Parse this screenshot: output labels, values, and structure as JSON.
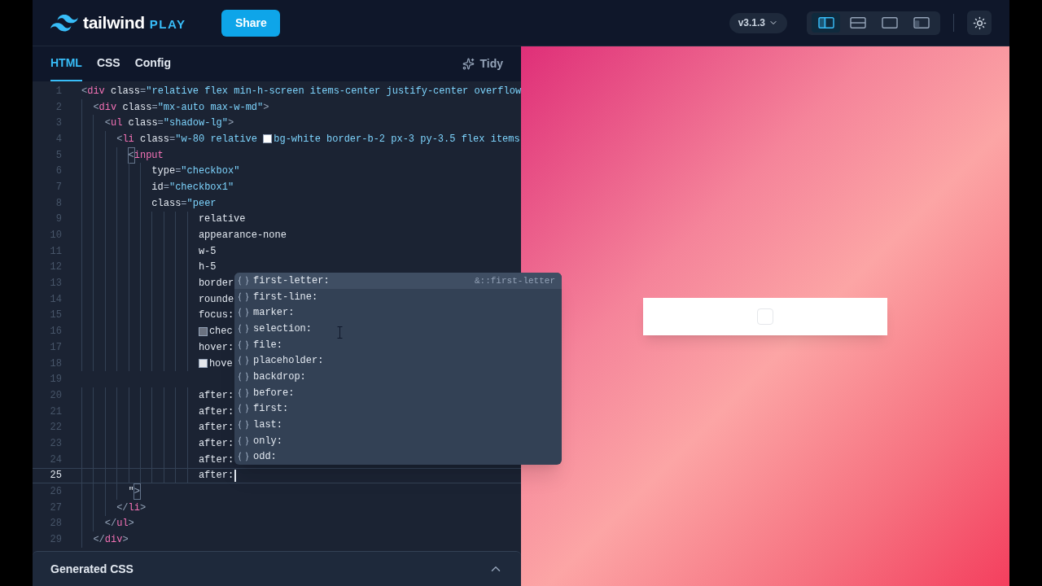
{
  "header": {
    "logo_text": "tailwind",
    "logo_suffix": "PLAY",
    "share_button": "Share",
    "version": "v3.1.3",
    "layouts": [
      {
        "kind": "vertical",
        "selected": true
      },
      {
        "kind": "horizontal",
        "selected": false
      },
      {
        "kind": "preview",
        "selected": false
      },
      {
        "kind": "responsive",
        "selected": false
      }
    ]
  },
  "tabs": [
    {
      "label": "HTML",
      "selected": true
    },
    {
      "label": "CSS",
      "selected": false
    },
    {
      "label": "Config",
      "selected": false
    }
  ],
  "tidy_button": "Tidy",
  "editor": {
    "lines": [
      {
        "number": "1",
        "current": false,
        "tokens": [
          {
            "kind": "p",
            "t": "<"
          },
          {
            "kind": "tag",
            "t": "div"
          },
          {
            "kind": "attr",
            "t": " class"
          },
          {
            "kind": "p",
            "t": "="
          },
          {
            "kind": "str",
            "t": "\"relative flex min-h-screen items-center justify-center overflow"
          }
        ]
      },
      {
        "number": "2",
        "current": false,
        "tokens": [
          {
            "kind": "p",
            "t": "  <"
          },
          {
            "kind": "tag",
            "t": "div"
          },
          {
            "kind": "attr",
            "t": " class"
          },
          {
            "kind": "p",
            "t": "="
          },
          {
            "kind": "str",
            "t": "\"mx-auto max-w-md\""
          },
          {
            "kind": "p",
            "t": ">"
          }
        ]
      },
      {
        "number": "3",
        "current": false,
        "tokens": [
          {
            "kind": "p",
            "t": "    <"
          },
          {
            "kind": "tag",
            "t": "ul"
          },
          {
            "kind": "attr",
            "t": " class"
          },
          {
            "kind": "p",
            "t": "="
          },
          {
            "kind": "str",
            "t": "\"shadow-lg\""
          },
          {
            "kind": "p",
            "t": ">"
          }
        ]
      },
      {
        "number": "4",
        "current": false,
        "tokens": [
          {
            "kind": "p",
            "t": "      <"
          },
          {
            "kind": "tag",
            "t": "li"
          },
          {
            "kind": "attr",
            "t": " class"
          },
          {
            "kind": "p",
            "t": "="
          },
          {
            "kind": "str",
            "t": "\"w-80 relative "
          },
          {
            "kind": "str",
            "color": "#ffffff",
            "t": "bg-white border-b-2 px-3 py-3.5 flex items"
          }
        ]
      },
      {
        "number": "5",
        "current": false,
        "tokens": [
          {
            "kind": "match",
            "t": "        <"
          },
          {
            "kind": "tag",
            "t": "input"
          }
        ]
      },
      {
        "number": "6",
        "current": false,
        "tokens": [
          {
            "kind": "attr",
            "t": "            type"
          },
          {
            "kind": "p",
            "t": "="
          },
          {
            "kind": "str",
            "t": "\"checkbox\""
          }
        ]
      },
      {
        "number": "7",
        "current": false,
        "tokens": [
          {
            "kind": "attr",
            "t": "            id"
          },
          {
            "kind": "p",
            "t": "="
          },
          {
            "kind": "str",
            "t": "\"checkbox1\""
          }
        ]
      },
      {
        "number": "8",
        "current": false,
        "tokens": [
          {
            "kind": "attr",
            "t": "            class"
          },
          {
            "kind": "p",
            "t": "="
          },
          {
            "kind": "str",
            "t": "\"peer"
          }
        ]
      },
      {
        "number": "9",
        "current": false,
        "tokens": [
          {
            "kind": "txt",
            "t": "                    relative"
          }
        ]
      },
      {
        "number": "10",
        "current": false,
        "tokens": [
          {
            "kind": "txt",
            "t": "                    appearance-none"
          }
        ]
      },
      {
        "number": "11",
        "current": false,
        "tokens": [
          {
            "kind": "txt",
            "t": "                    w-5"
          }
        ]
      },
      {
        "number": "12",
        "current": false,
        "tokens": [
          {
            "kind": "txt",
            "t": "                    h-5"
          }
        ]
      },
      {
        "number": "13",
        "current": false,
        "tokens": [
          {
            "kind": "txt",
            "t": "                    border"
          }
        ]
      },
      {
        "number": "14",
        "current": false,
        "tokens": [
          {
            "kind": "txt",
            "t": "                    rounde"
          }
        ]
      },
      {
        "number": "15",
        "current": false,
        "tokens": [
          {
            "kind": "txt",
            "t": "                    focus:"
          }
        ]
      },
      {
        "number": "16",
        "current": false,
        "tokens": [
          {
            "kind": "txt",
            "color": "#6b7280",
            "t": "                    chec"
          }
        ]
      },
      {
        "number": "17",
        "current": false,
        "tokens": [
          {
            "kind": "txt",
            "t": "                    hover:"
          }
        ]
      },
      {
        "number": "18",
        "current": false,
        "tokens": [
          {
            "kind": "txt",
            "color": "#e5e7eb",
            "t": "                    hove"
          }
        ]
      },
      {
        "number": "19",
        "current": false
      },
      {
        "number": "20",
        "current": false,
        "tokens": [
          {
            "kind": "txt",
            "t": "                    after:"
          }
        ]
      },
      {
        "number": "21",
        "current": false,
        "tokens": [
          {
            "kind": "txt",
            "t": "                    after:"
          }
        ]
      },
      {
        "number": "22",
        "current": false,
        "tokens": [
          {
            "kind": "txt",
            "t": "                    after:"
          }
        ]
      },
      {
        "number": "23",
        "current": false,
        "tokens": [
          {
            "kind": "txt",
            "t": "                    after:"
          }
        ]
      },
      {
        "number": "24",
        "current": false,
        "tokens": [
          {
            "kind": "txt",
            "t": "                    after:"
          }
        ]
      },
      {
        "number": "25",
        "current": true,
        "tokens": [
          {
            "kind": "txt",
            "t": "                    after:"
          }
        ]
      },
      {
        "number": "26",
        "current": false,
        "tokens": [
          {
            "kind": "txt",
            "t": "        \""
          },
          {
            "kind": "match",
            "t": ">"
          }
        ]
      },
      {
        "number": "27",
        "current": false,
        "tokens": [
          {
            "kind": "p",
            "t": "      </"
          },
          {
            "kind": "tag",
            "t": "li"
          },
          {
            "kind": "p",
            "t": ">"
          }
        ]
      },
      {
        "number": "28",
        "current": false,
        "tokens": [
          {
            "kind": "p",
            "t": "    </"
          },
          {
            "kind": "tag",
            "t": "ul"
          },
          {
            "kind": "p",
            "t": ">"
          }
        ]
      },
      {
        "number": "29",
        "current": false,
        "tokens": [
          {
            "kind": "p",
            "t": "  </"
          },
          {
            "kind": "tag",
            "t": "div"
          },
          {
            "kind": "p",
            "t": ">"
          }
        ]
      }
    ]
  },
  "autocomplete": {
    "items": [
      {
        "label": "first-letter:",
        "detail": "&::first-letter",
        "selected": true
      },
      {
        "label": "first-line:",
        "selected": false
      },
      {
        "label": "marker:",
        "selected": false
      },
      {
        "label": "selection:",
        "selected": false
      },
      {
        "label": "file:",
        "selected": false
      },
      {
        "label": "placeholder:",
        "selected": false
      },
      {
        "label": "backdrop:",
        "selected": false
      },
      {
        "label": "before:",
        "selected": false
      },
      {
        "label": "first:",
        "selected": false
      },
      {
        "label": "last:",
        "selected": false
      },
      {
        "label": "only:",
        "selected": false
      },
      {
        "label": "odd:",
        "selected": false
      }
    ]
  },
  "generated_css": {
    "title": "Generated CSS",
    "expanded": false
  },
  "preview": {
    "checkbox": {
      "checked": false
    }
  }
}
